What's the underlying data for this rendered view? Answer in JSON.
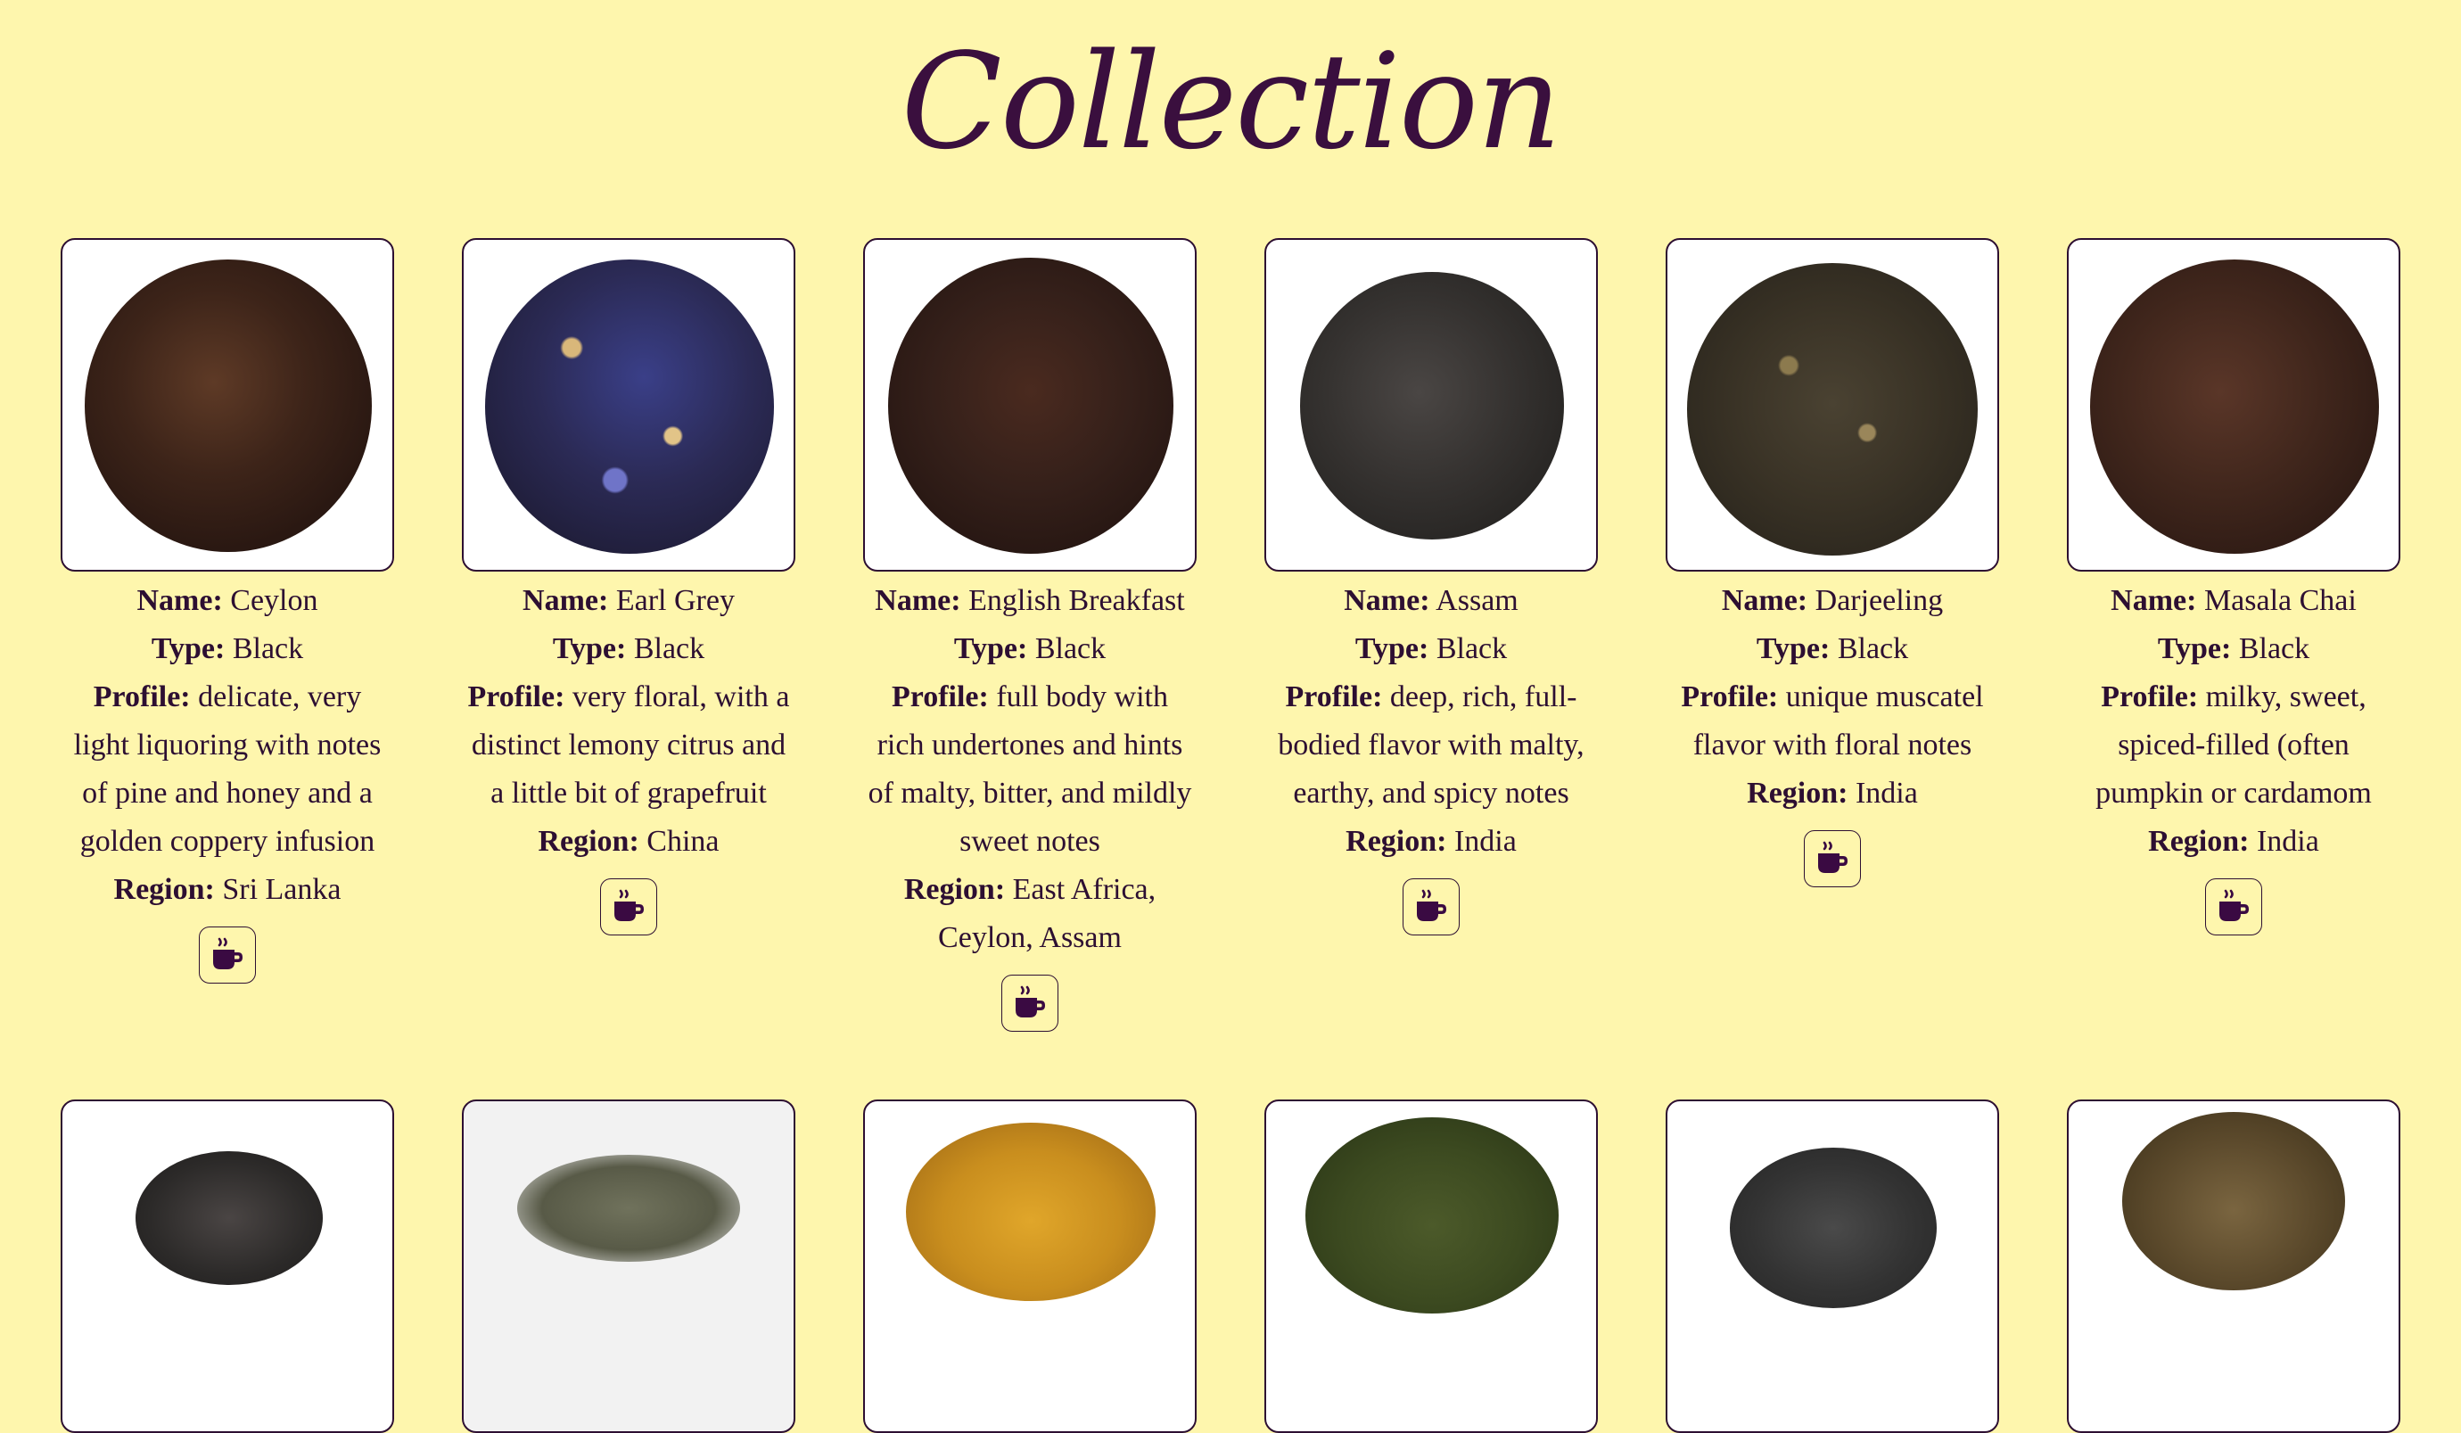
{
  "header": {
    "title": "Collection"
  },
  "labels": {
    "name": "Name:",
    "type": "Type:",
    "profile": "Profile:",
    "region": "Region:"
  },
  "teas": [
    {
      "name": "Ceylon",
      "type": "Black",
      "profile": "delicate, very light liquoring with notes of pine and honey and a golden coppery infusion",
      "region": "Sri Lanka"
    },
    {
      "name": "Earl Grey",
      "type": "Black",
      "profile": "very floral, with a distinct lemony citrus and a little bit of grapefruit",
      "region": "China"
    },
    {
      "name": "English Breakfast",
      "type": "Black",
      "profile": "full body with rich undertones and hints of malty, bitter, and mildly sweet notes",
      "region": "East Africa, Ceylon, Assam"
    },
    {
      "name": "Assam",
      "type": "Black",
      "profile": "deep, rich, full-bodied flavor with malty, earthy, and spicy notes",
      "region": "India"
    },
    {
      "name": "Darjeeling",
      "type": "Black",
      "profile": "unique muscatel flavor with floral notes",
      "region": "India"
    },
    {
      "name": "Masala Chai",
      "type": "Black",
      "profile": "milky, sweet, spiced-filled (often pumpkin or cardamom",
      "region": "India"
    }
  ],
  "icons": {
    "order_button": "coffee-cup-icon"
  },
  "colors": {
    "background": "#fef6ad",
    "accent": "#2d0f32"
  }
}
